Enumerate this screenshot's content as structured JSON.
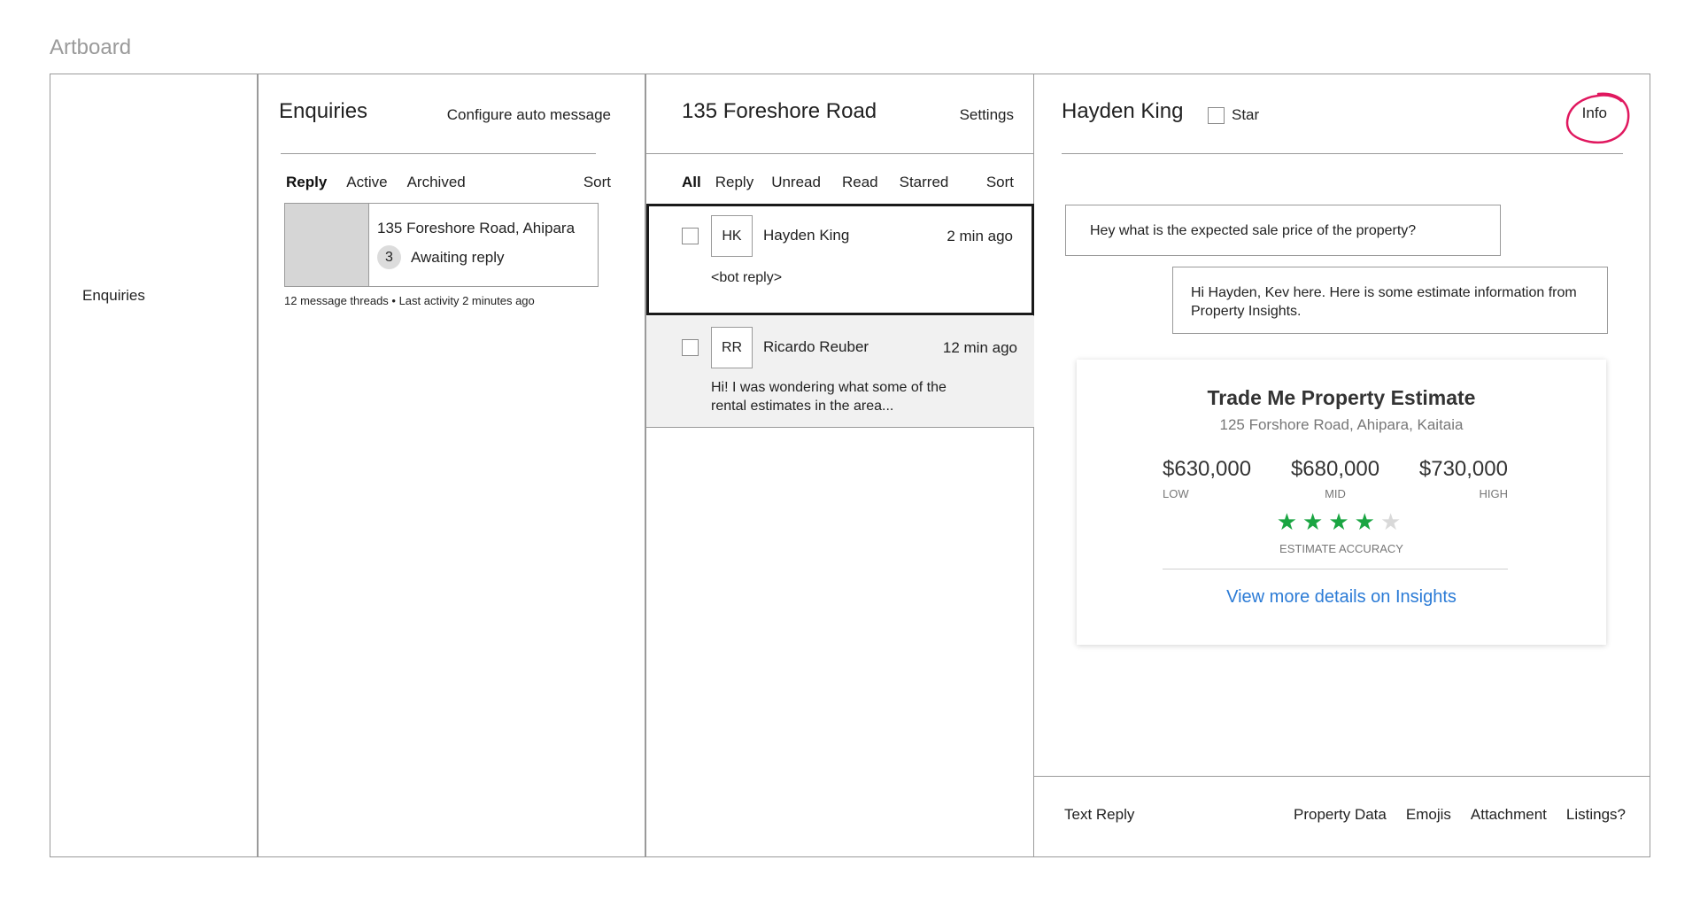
{
  "artboard_label": "Artboard",
  "nav": {
    "enquiries": "Enquiries"
  },
  "enquiries": {
    "title": "Enquiries",
    "configure": "Configure auto message",
    "tabs": [
      "Reply",
      "Active",
      "Archived"
    ],
    "sort": "Sort",
    "property": {
      "address": "135 Foreshore Road, Ahipara",
      "count": "3",
      "status": "Awaiting reply"
    },
    "meta": "12 message threads • Last activity 2 minutes ago"
  },
  "threads_panel": {
    "title": "135 Foreshore Road",
    "settings": "Settings",
    "tabs": [
      "All",
      "Reply",
      "Unread",
      "Read",
      "Starred"
    ],
    "sort": "Sort",
    "threads": [
      {
        "initials": "HK",
        "name": "Hayden King",
        "time": "2 min ago",
        "preview": "<bot reply>"
      },
      {
        "initials": "RR",
        "name": "Ricardo Reuber",
        "time": "12 min ago",
        "preview": "Hi! I was wondering what some of the rental estimates in the area..."
      }
    ]
  },
  "conversation": {
    "name": "Hayden King",
    "star": "Star",
    "info": "Info",
    "messages": {
      "incoming": "Hey what is the expected sale price of the property?",
      "outgoing": "Hi Hayden, Kev here. Here is some estimate information from Property Insights."
    },
    "estimate": {
      "title": "Trade Me Property Estimate",
      "address": "125 Forshore Road, Ahipara, Kaitaia",
      "low_value": "$630,000",
      "low_label": "LOW",
      "mid_value": "$680,000",
      "mid_label": "MID",
      "high_value": "$730,000",
      "high_label": "HIGH",
      "accuracy_stars": 4,
      "accuracy_max": 5,
      "accuracy_label": "ESTIMATE ACCURACY",
      "link": "View more details on Insights"
    },
    "compose": {
      "text_reply": "Text Reply",
      "actions": [
        "Property Data",
        "Emojis",
        "Attachment",
        "Listings?"
      ]
    }
  },
  "colors": {
    "border": "#9a9a9a",
    "star_green": "#1aa542",
    "link_blue": "#2b7bd6",
    "annotation_pink": "#e0185f"
  }
}
